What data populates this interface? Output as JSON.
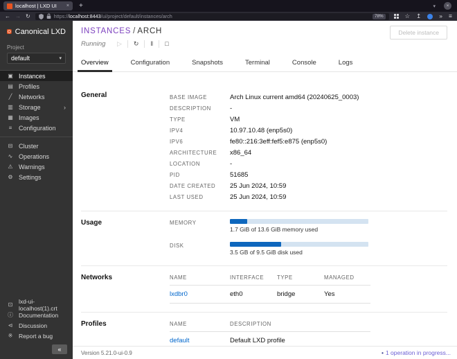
{
  "browser": {
    "tab_title": "localhost | LXD UI",
    "url_prefix": "https://",
    "url_host": "localhost:8443",
    "url_path": "/ui/project/default/instances/arch",
    "zoom_badge": "78%",
    "icons": {
      "tab_close": "×",
      "new_tab": "+",
      "tabs_chevron": "▾",
      "window_close": "×",
      "back": "←",
      "forward": "→",
      "reload": "↻",
      "star": "☆",
      "upload": "↥",
      "overflow": "»",
      "menu": "≡"
    }
  },
  "sidebar": {
    "brand": "Canonical LXD",
    "project_label": "Project",
    "project_value": "default",
    "project_chevron": "▾",
    "nav": [
      {
        "icon": "instances-icon",
        "glyph": "▣",
        "label": "Instances",
        "active": true
      },
      {
        "icon": "profiles-icon",
        "glyph": "▤",
        "label": "Profiles"
      },
      {
        "icon": "networks-icon",
        "glyph": "╱",
        "label": "Networks"
      },
      {
        "icon": "storage-icon",
        "glyph": "▥",
        "label": "Storage",
        "chevron": "›"
      },
      {
        "icon": "images-icon",
        "glyph": "▦",
        "label": "Images"
      },
      {
        "icon": "configuration-icon",
        "glyph": "≡",
        "label": "Configuration"
      }
    ],
    "nav2": [
      {
        "icon": "cluster-icon",
        "glyph": "⊟",
        "label": "Cluster"
      },
      {
        "icon": "operations-icon",
        "glyph": "∿",
        "label": "Operations"
      },
      {
        "icon": "warnings-icon",
        "glyph": "⚠",
        "label": "Warnings"
      },
      {
        "icon": "settings-icon",
        "glyph": "⚙",
        "label": "Settings"
      }
    ],
    "footer_items": [
      {
        "icon": "certificate-icon",
        "glyph": "⊡",
        "label": "lxd-ui-localhost(1).crt"
      },
      {
        "icon": "documentation-icon",
        "glyph": "ⓘ",
        "label": "Documentation"
      },
      {
        "icon": "discussion-icon",
        "glyph": "⊲",
        "label": "Discussion"
      },
      {
        "icon": "report-bug-icon",
        "glyph": "※",
        "label": "Report a bug"
      }
    ],
    "collapse_glyph": "«"
  },
  "page": {
    "breadcrumb_parent": "INSTANCES",
    "breadcrumb_sep": "/",
    "breadcrumb_current": "ARCH",
    "status": "Running",
    "delete_button": "Delete instance",
    "controls": {
      "play": "▷",
      "restart": "↻",
      "pause": "‖",
      "stop": "□"
    }
  },
  "tabs": [
    {
      "label": "Overview",
      "active": true
    },
    {
      "label": "Configuration"
    },
    {
      "label": "Snapshots"
    },
    {
      "label": "Terminal"
    },
    {
      "label": "Console"
    },
    {
      "label": "Logs"
    }
  ],
  "general": {
    "title": "General",
    "rows": [
      {
        "label": "BASE IMAGE",
        "value": "Arch Linux current amd64 (20240625_0003)"
      },
      {
        "label": "DESCRIPTION",
        "value": "-"
      },
      {
        "label": "TYPE",
        "value": "VM"
      },
      {
        "label": "IPV4",
        "value": "10.97.10.48 (enp5s0)"
      },
      {
        "label": "IPV6",
        "value": "fe80::216:3eff:fef5:e875 (enp5s0)"
      },
      {
        "label": "ARCHITECTURE",
        "value": "x86_64"
      },
      {
        "label": "LOCATION",
        "value": "-"
      },
      {
        "label": "PID",
        "value": "51685"
      },
      {
        "label": "DATE CREATED",
        "value": "25 Jun 2024, 10:59"
      },
      {
        "label": "LAST USED",
        "value": "25 Jun 2024, 10:59"
      }
    ]
  },
  "usage": {
    "title": "Usage",
    "meters": [
      {
        "label": "MEMORY",
        "percent": 12.5,
        "caption": "1.7 GiB of 13.6 GiB memory used"
      },
      {
        "label": "DISK",
        "percent": 37,
        "caption": "3.5 GB of 9.5 GiB disk used"
      }
    ]
  },
  "networks": {
    "title": "Networks",
    "headers": [
      "NAME",
      "INTERFACE",
      "TYPE",
      "MANAGED"
    ],
    "rows": [
      {
        "name": "lxdbr0",
        "interface": "eth0",
        "type": "bridge",
        "managed": "Yes"
      }
    ]
  },
  "profiles": {
    "title": "Profiles",
    "headers": [
      "NAME",
      "DESCRIPTION"
    ],
    "rows": [
      {
        "name": "default",
        "description": "Default LXD profile"
      }
    ]
  },
  "statusbar": {
    "version": "Version 5.21.0-ui-0.9",
    "bullet": "•",
    "operations": "1 operation in progress..."
  },
  "colors": {
    "brand_orange": "#E95420",
    "breadcrumb_purple": "#7d42bf",
    "link_blue": "#0066cc",
    "meter_fill_blue": "#0e67bd",
    "meter_track_blue": "#d4e3f1",
    "operation_purple": "#6b5ed4",
    "tab_active_underline": "#2d2d2d"
  }
}
